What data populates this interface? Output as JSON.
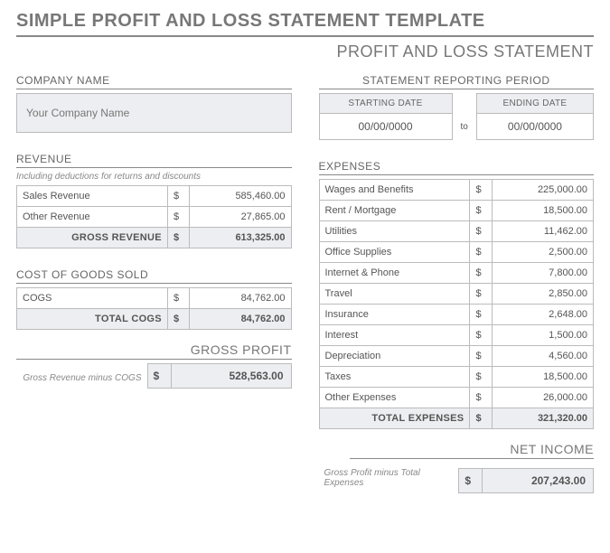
{
  "main_title": "SIMPLE PROFIT AND LOSS STATEMENT TEMPLATE",
  "sub_title": "PROFIT AND LOSS STATEMENT",
  "company": {
    "header": "COMPANY NAME",
    "placeholder": "Your Company Name"
  },
  "period": {
    "header": "STATEMENT REPORTING PERIOD",
    "start_label": "STARTING DATE",
    "end_label": "ENDING DATE",
    "start_value": "00/00/0000",
    "to": "to",
    "end_value": "00/00/0000"
  },
  "revenue": {
    "header": "REVENUE",
    "note": "Including deductions for returns and discounts",
    "rows": [
      {
        "label": "Sales Revenue",
        "value": "585,460.00"
      },
      {
        "label": "Other Revenue",
        "value": "27,865.00"
      }
    ],
    "total_label": "GROSS REVENUE",
    "total_value": "613,325.00"
  },
  "cogs": {
    "header": "COST OF GOODS SOLD",
    "rows": [
      {
        "label": "COGS",
        "value": "84,762.00"
      }
    ],
    "total_label": "TOTAL COGS",
    "total_value": "84,762.00"
  },
  "gross_profit": {
    "header": "GROSS PROFIT",
    "note": "Gross Revenue minus COGS",
    "value": "528,563.00"
  },
  "expenses": {
    "header": "EXPENSES",
    "rows": [
      {
        "label": "Wages and Benefits",
        "value": "225,000.00"
      },
      {
        "label": "Rent / Mortgage",
        "value": "18,500.00"
      },
      {
        "label": "Utilities",
        "value": "11,462.00"
      },
      {
        "label": "Office Supplies",
        "value": "2,500.00"
      },
      {
        "label": "Internet & Phone",
        "value": "7,800.00"
      },
      {
        "label": "Travel",
        "value": "2,850.00"
      },
      {
        "label": "Insurance",
        "value": "2,648.00"
      },
      {
        "label": "Interest",
        "value": "1,500.00"
      },
      {
        "label": "Depreciation",
        "value": "4,560.00"
      },
      {
        "label": "Taxes",
        "value": "18,500.00"
      },
      {
        "label": "Other Expenses",
        "value": "26,000.00"
      }
    ],
    "total_label": "TOTAL EXPENSES",
    "total_value": "321,320.00"
  },
  "net_income": {
    "header": "NET INCOME",
    "note": "Gross Profit minus Total Expenses",
    "value": "207,243.00"
  },
  "currency": "$"
}
